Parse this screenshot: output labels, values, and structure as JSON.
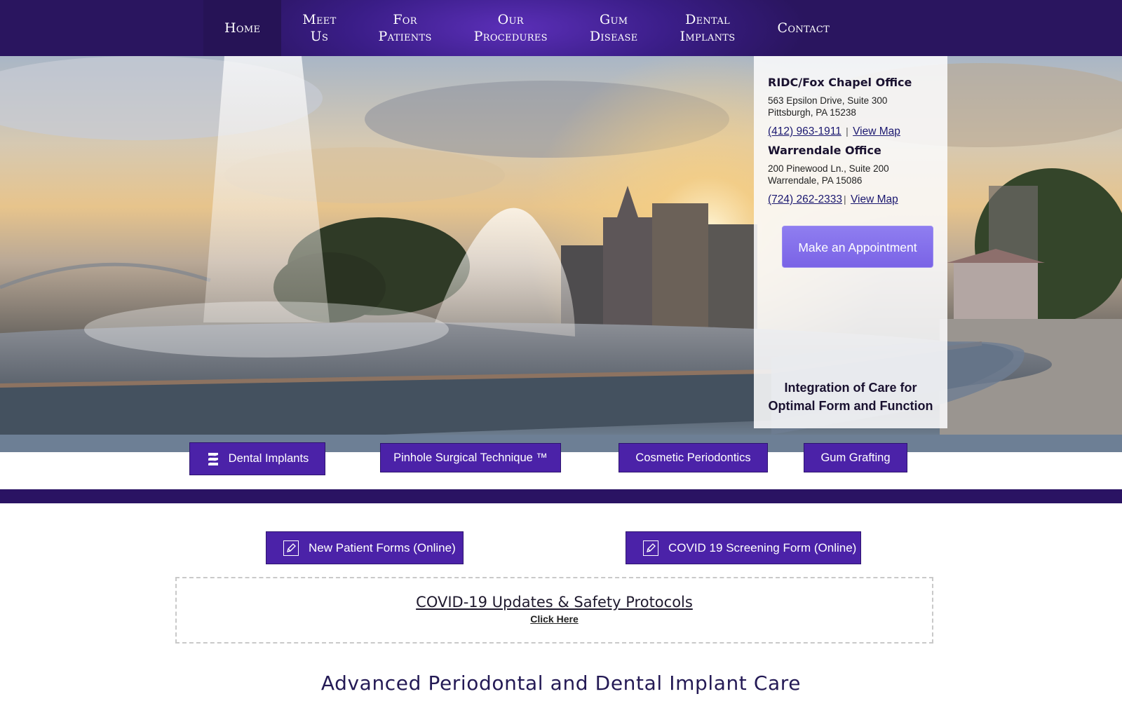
{
  "nav": {
    "items": [
      {
        "line1": "Home",
        "line2": ""
      },
      {
        "line1": "Meet",
        "line2": "Us"
      },
      {
        "line1": "For",
        "line2": "Patients"
      },
      {
        "line1": "Our",
        "line2": "Procedures"
      },
      {
        "line1": "Gum",
        "line2": "Disease"
      },
      {
        "line1": "Dental",
        "line2": "Implants"
      },
      {
        "line1": "Contact",
        "line2": ""
      }
    ]
  },
  "offices": [
    {
      "name": "RIDC/Fox Chapel Office",
      "address1": "563 Epsilon Drive, Suite 300",
      "address2": "Pittsburgh, PA 15238",
      "phone": "(412) 963-1911",
      "separator": "|",
      "map_label": "View Map"
    },
    {
      "name": "Warrendale Office",
      "address1": "200 Pinewood Ln., Suite 200",
      "address2": "Warrendale, PA 15086",
      "phone": "(724) 262-2333",
      "separator": "|",
      "map_label": "View Map"
    }
  ],
  "appointment_label": "Make an Appointment",
  "tagline": {
    "line1": "Integration of Care for",
    "line2": "Optimal Form and Function"
  },
  "services": [
    "Dental Implants",
    "Pinhole Surgical Technique ™",
    "Cosmetic Periodontics",
    "Gum Grafting"
  ],
  "forms": [
    "New Patient Forms (Online)",
    "COVID 19 Screening Form (Online)"
  ],
  "covid": {
    "title": "COVID-19 Updates & Safety Protocols",
    "link": "Click Here"
  },
  "heading": "Advanced Periodontal and Dental Implant Care",
  "colors": {
    "nav_bg": "#2a155f",
    "button_purple": "#4b22a8",
    "appointment": "#7a63e6",
    "band": "#2a1363"
  }
}
